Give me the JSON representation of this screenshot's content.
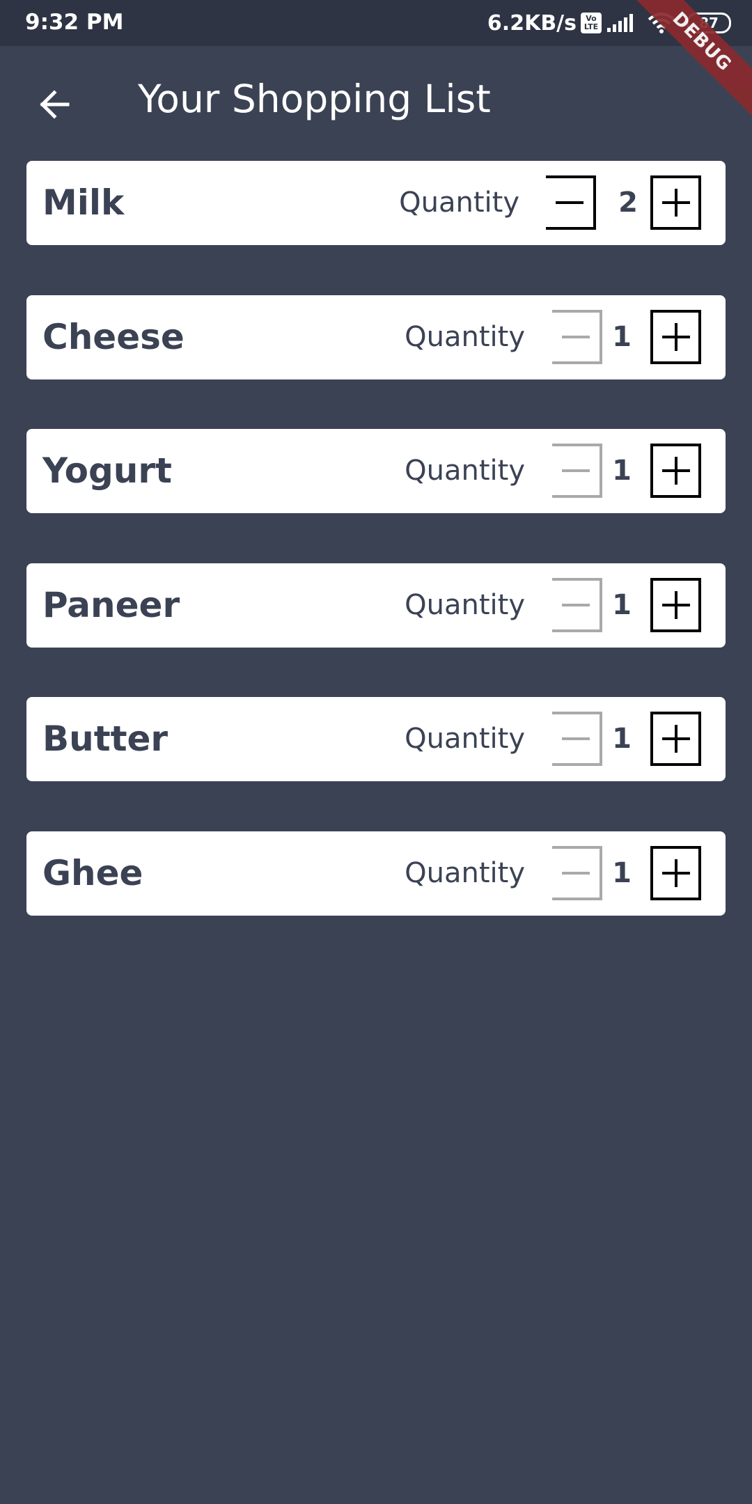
{
  "status_bar": {
    "time": "9:32 PM",
    "net_speed": "6.2KB/s",
    "volte_top": "Vo",
    "volte_bottom": "LTE",
    "battery_level": "87",
    "icons": [
      "volte-icon",
      "signal-icon",
      "wifi-icon",
      "battery-icon"
    ]
  },
  "debug_banner": "DEBUG",
  "app_bar": {
    "back_icon": "arrow-left-icon",
    "title": "Your Shopping List"
  },
  "colors": {
    "background": "#3b4254",
    "status_bar": "#2e3444",
    "card": "#ffffff",
    "text_dark": "#3b4254",
    "stepper_active": "#000000",
    "stepper_disabled": "#a9a9a9",
    "debug_ribbon": "#8a2a2e"
  },
  "items": [
    {
      "name": "Milk",
      "quantity_label": "Quantity",
      "quantity": "2",
      "minus_enabled": true
    },
    {
      "name": "Cheese",
      "quantity_label": "Quantity",
      "quantity": "1",
      "minus_enabled": false
    },
    {
      "name": "Yogurt",
      "quantity_label": "Quantity",
      "quantity": "1",
      "minus_enabled": false
    },
    {
      "name": "Paneer",
      "quantity_label": "Quantity",
      "quantity": "1",
      "minus_enabled": false
    },
    {
      "name": "Butter",
      "quantity_label": "Quantity",
      "quantity": "1",
      "minus_enabled": false
    },
    {
      "name": "Ghee",
      "quantity_label": "Quantity",
      "quantity": "1",
      "minus_enabled": false
    }
  ]
}
